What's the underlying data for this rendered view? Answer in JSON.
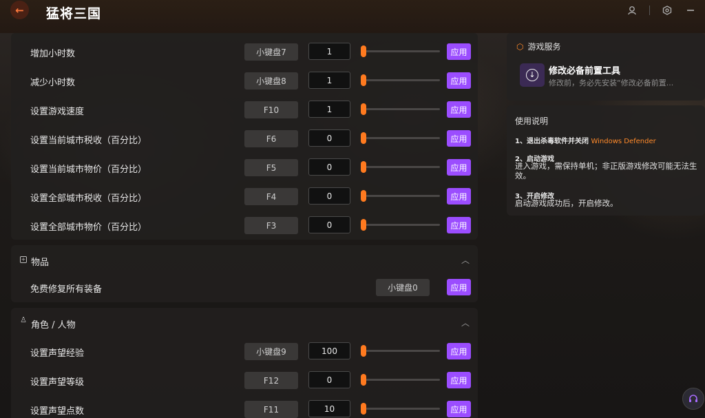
{
  "header": {
    "back_icon": "arrow-left-icon",
    "title": "猛将三国",
    "icons": [
      "user-icon",
      "settings-icon",
      "minimize-icon"
    ]
  },
  "panel1": {
    "rows": [
      {
        "label": "增加小时数",
        "hotkey": "小键盘7",
        "value": "1",
        "slider": 0,
        "apply": "应用"
      },
      {
        "label": "减少小时数",
        "hotkey": "小键盘8",
        "value": "1",
        "slider": 0,
        "apply": "应用"
      },
      {
        "label": "设置游戏速度",
        "hotkey": "F10",
        "value": "1",
        "slider": 0,
        "apply": "应用"
      },
      {
        "label": "设置当前城市税收（百分比）",
        "hotkey": "F6",
        "value": "0",
        "slider": 0,
        "apply": "应用"
      },
      {
        "label": "设置当前城市物价（百分比）",
        "hotkey": "F5",
        "value": "0",
        "slider": 0,
        "apply": "应用"
      },
      {
        "label": "设置全部城市税收（百分比）",
        "hotkey": "F4",
        "value": "0",
        "slider": 0,
        "apply": "应用"
      },
      {
        "label": "设置全部城市物价（百分比）",
        "hotkey": "F3",
        "value": "0",
        "slider": 0,
        "apply": "应用"
      }
    ]
  },
  "items_section": {
    "title": "物品",
    "rows": [
      {
        "label": "免费修复所有装备",
        "hotkey": "小键盘0",
        "apply": "应用"
      }
    ]
  },
  "character_section": {
    "title": "角色 / 人物",
    "rows": [
      {
        "label": "设置声望经验",
        "hotkey": "小键盘9",
        "value": "100",
        "slider": 0,
        "apply": "应用"
      },
      {
        "label": "设置声望等级",
        "hotkey": "F12",
        "value": "0",
        "slider": 0,
        "apply": "应用"
      },
      {
        "label": "设置声望点数",
        "hotkey": "F11",
        "value": "10",
        "slider": 0,
        "apply": "应用"
      }
    ]
  },
  "service": {
    "title": "游戏服务",
    "tool_title": "修改必备前置工具",
    "tool_desc": "修改前，务必先安装“修改必备前置..."
  },
  "help": {
    "title": "使用说明",
    "step1_head": "1、退出杀毒软件并关闭",
    "step1_highlight": "Windows Defender",
    "step2_head": "2、启动游戏",
    "step2_text": "进入游戏，需保持单机；非正版游戏修改可能无法生效。",
    "step3_head": "3、开启修改",
    "step3_text": "启动游戏成功后，开启修改。"
  },
  "colors": {
    "accent": "#9b4dff",
    "slider": "#ff7a1f",
    "highlight": "#ff8a2a"
  }
}
